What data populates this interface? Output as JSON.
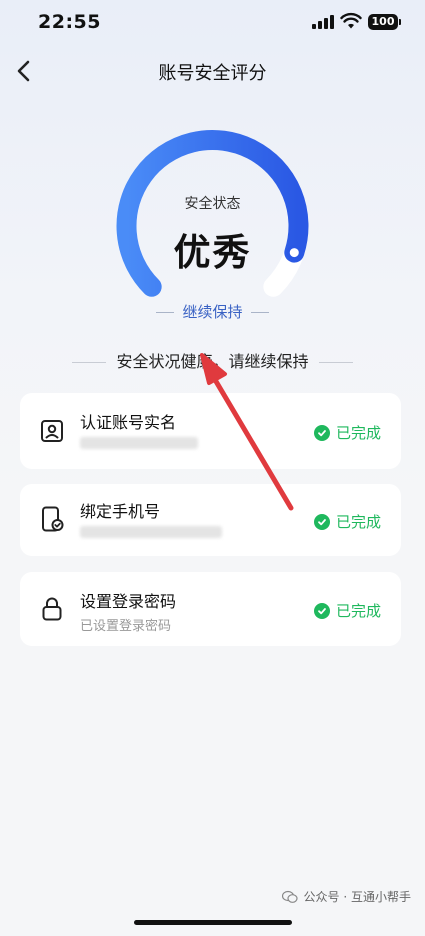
{
  "status_bar": {
    "time": "22:55",
    "battery": "100"
  },
  "nav": {
    "title": "账号安全评分",
    "back_icon": "chevron-left-icon"
  },
  "gauge": {
    "label": "安全状态",
    "value": "优秀",
    "action": "继续保持",
    "progress": 0.9,
    "colors": {
      "start": "#3f84f5",
      "end": "#2c5be6",
      "track": "#ffffff"
    }
  },
  "summary": "安全状况健康，请继续保持",
  "items": [
    {
      "title": "认证账号实名",
      "subtitle": "",
      "status": "已完成",
      "icon": "id-card-icon"
    },
    {
      "title": "绑定手机号",
      "subtitle": "",
      "status": "已完成",
      "icon": "phone-check-icon"
    },
    {
      "title": "设置登录密码",
      "subtitle": "已设置登录密码",
      "status": "已完成",
      "icon": "lock-icon"
    }
  ],
  "watermark": "公众号 · 互通小帮手",
  "colors": {
    "accent": "#3a62c4",
    "success": "#1fb85d",
    "annotation_arrow": "#e03a3e"
  }
}
